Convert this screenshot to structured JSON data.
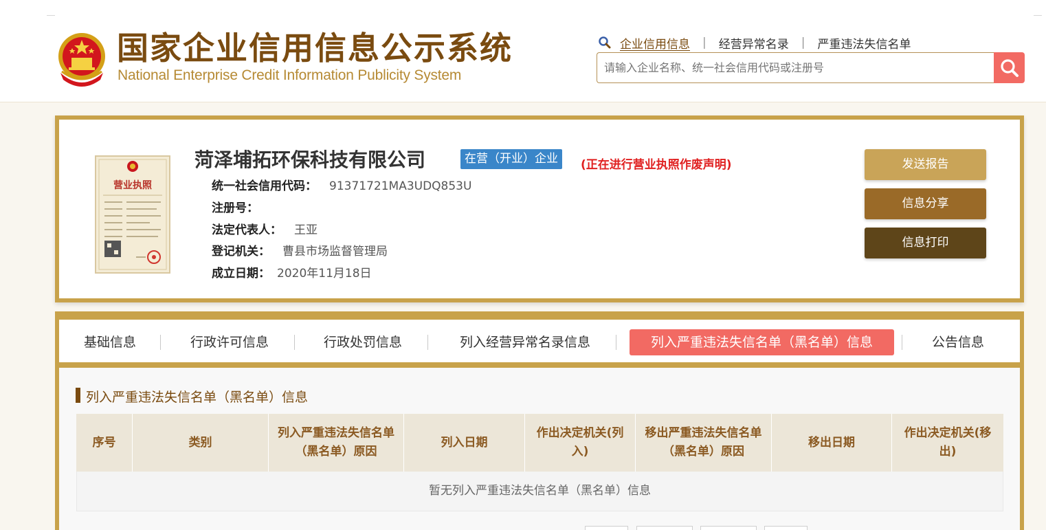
{
  "header": {
    "title": "国家企业信用信息公示系统",
    "subtitle": "National Enterprise Credit Information Publicity System",
    "nav": [
      "企业信用信息",
      "经营异常名录",
      "严重违法失信名单"
    ],
    "search_placeholder": "请输入企业名称、统一社会信用代码或注册号"
  },
  "company": {
    "name": "菏泽埔拓环保科技有限公司",
    "status": "在营（开业）企业",
    "notice": "(正在进行营业执照作废声明)",
    "fields": [
      {
        "label": "统一社会信用代码：",
        "value": "91371721MA3UDQ853U"
      },
      {
        "label": "注册号：",
        "value": ""
      },
      {
        "label": "法定代表人：",
        "value": "王亚"
      },
      {
        "label": "登记机关：",
        "value": "曹县市场监督管理局"
      },
      {
        "label": "成立日期：",
        "value": "2020年11月18日"
      }
    ],
    "license_title": "营业执照"
  },
  "actions": {
    "send": "发送报告",
    "share": "信息分享",
    "print": "信息打印"
  },
  "tabs": [
    {
      "label": "基础信息",
      "active": false
    },
    {
      "label": "行政许可信息",
      "active": false
    },
    {
      "label": "行政处罚信息",
      "active": false
    },
    {
      "label": "列入经营异常名录信息",
      "active": false
    },
    {
      "label": "列入严重违法失信名单（黑名单）信息",
      "active": true
    },
    {
      "label": "公告信息",
      "active": false
    }
  ],
  "section": {
    "title": "列入严重违法失信名单（黑名单）信息",
    "columns": [
      "序号",
      "类别",
      "列入严重违法失信名单（黑名单）原因",
      "列入日期",
      "作出决定机关(列入)",
      "移出严重违法失信名单（黑名单）原因",
      "移出日期",
      "作出决定机关(移出)"
    ],
    "empty_text": "暂无列入严重违法失信名单（黑名单）信息"
  },
  "colors": {
    "brand_brown": "#7a4b10",
    "gold_border": "#c8a24a",
    "accent_red": "#f26a63",
    "status_blue": "#3a86c9",
    "notice_red": "#e02020"
  }
}
